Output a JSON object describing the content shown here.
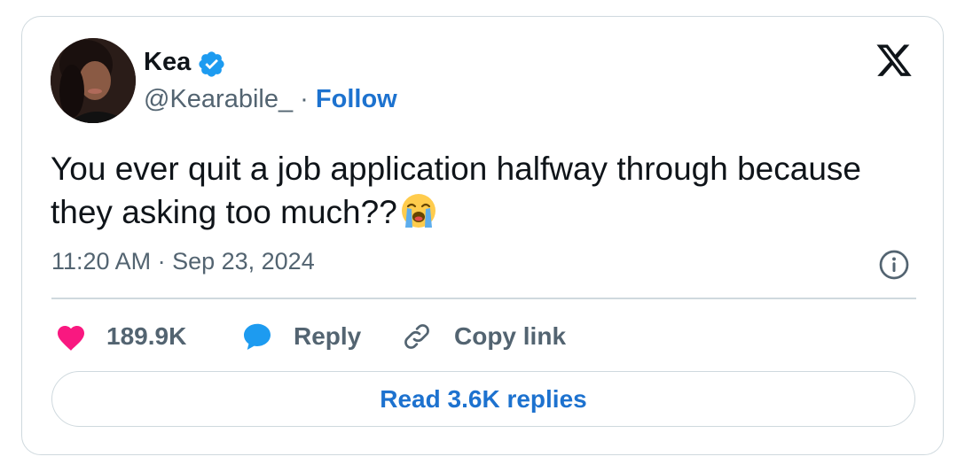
{
  "colors": {
    "follow_blue": "#1d72cf",
    "verified_blue": "#1d9bf0",
    "like_pink": "#f91880",
    "muted_gray": "#536471",
    "border": "#cfd9de",
    "text": "#0f1419"
  },
  "author": {
    "name": "Kea",
    "handle": "@Kearabile_",
    "separator": "·",
    "follow_label": "Follow",
    "verified": true
  },
  "tweet": {
    "text": "You ever quit a job application halfway through because they asking too much??",
    "emoji_icon": "loudly-crying-face-emoji",
    "timestamp": "11:20 AM · Sep 23, 2024"
  },
  "actions": {
    "likes": "189.9K",
    "reply_label": "Reply",
    "copy_link_label": "Copy link"
  },
  "read_replies_label": "Read 3.6K replies",
  "icons": {
    "brand": "x-logo-icon",
    "info": "info-icon",
    "like": "heart-icon",
    "reply": "speech-bubble-icon",
    "copy": "link-icon",
    "verified": "verified-badge-icon"
  }
}
